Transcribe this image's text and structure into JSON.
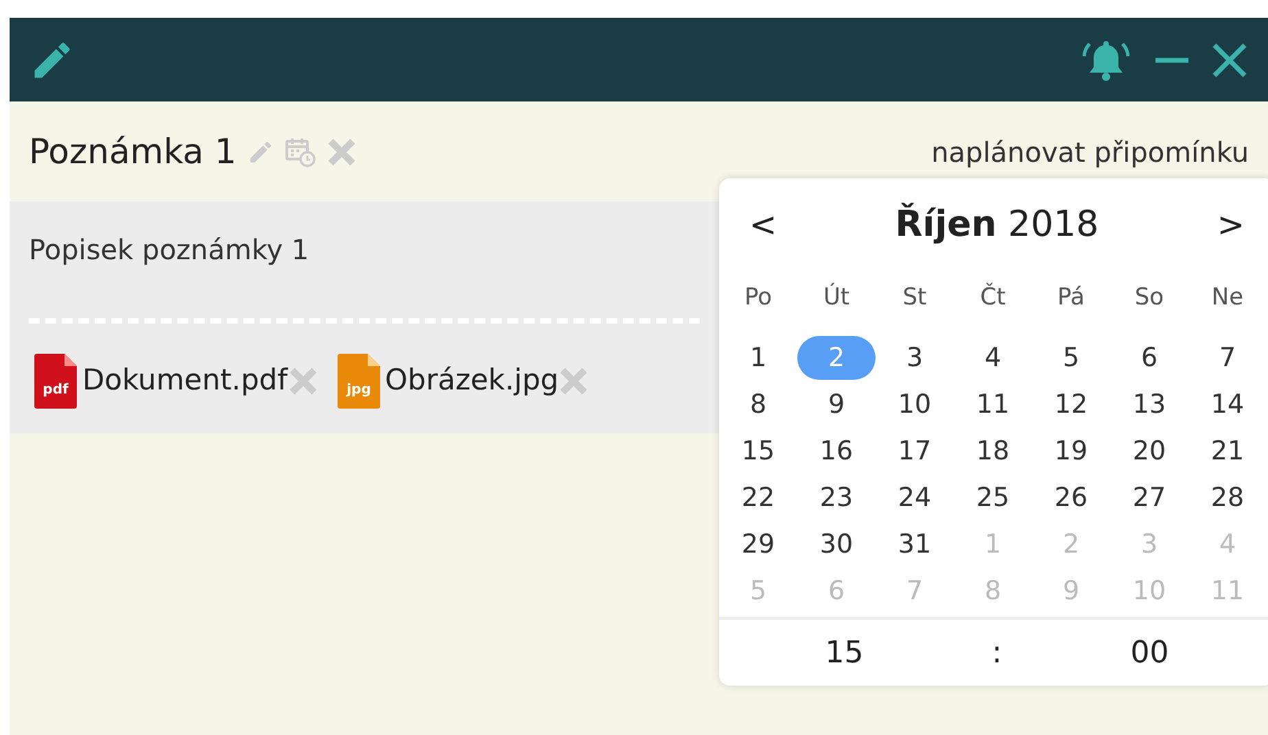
{
  "note": {
    "title": "Poznámka 1",
    "description": "Popisek poznámky 1",
    "attachments": [
      {
        "kind": "pdf",
        "badge": "pdf",
        "name": "Dokument.pdf"
      },
      {
        "kind": "jpg",
        "badge": "jpg",
        "name": "Obrázek.jpg"
      }
    ]
  },
  "reminder": {
    "label": "naplánovat připomínku"
  },
  "calendar": {
    "prev": "<",
    "next": ">",
    "month": "**Říjen** 2018",
    "weekdays": [
      "Po",
      "Út",
      "St",
      "Čt",
      "Pá",
      "So",
      "Ne"
    ],
    "days": [
      {
        "label": "1",
        "outside": false,
        "selected": false
      },
      {
        "label": "2",
        "outside": false,
        "selected": true
      },
      {
        "label": "3",
        "outside": false,
        "selected": false
      },
      {
        "label": "4",
        "outside": false,
        "selected": false
      },
      {
        "label": "5",
        "outside": false,
        "selected": false
      },
      {
        "label": "6",
        "outside": false,
        "selected": false
      },
      {
        "label": "7",
        "outside": false,
        "selected": false
      },
      {
        "label": "8",
        "outside": false,
        "selected": false
      },
      {
        "label": "9",
        "outside": false,
        "selected": false
      },
      {
        "label": "10",
        "outside": false,
        "selected": false
      },
      {
        "label": "11",
        "outside": false,
        "selected": false
      },
      {
        "label": "12",
        "outside": false,
        "selected": false
      },
      {
        "label": "13",
        "outside": false,
        "selected": false
      },
      {
        "label": "14",
        "outside": false,
        "selected": false
      },
      {
        "label": "15",
        "outside": false,
        "selected": false
      },
      {
        "label": "16",
        "outside": false,
        "selected": false
      },
      {
        "label": "17",
        "outside": false,
        "selected": false
      },
      {
        "label": "18",
        "outside": false,
        "selected": false
      },
      {
        "label": "19",
        "outside": false,
        "selected": false
      },
      {
        "label": "20",
        "outside": false,
        "selected": false
      },
      {
        "label": "21",
        "outside": false,
        "selected": false
      },
      {
        "label": "22",
        "outside": false,
        "selected": false
      },
      {
        "label": "23",
        "outside": false,
        "selected": false
      },
      {
        "label": "24",
        "outside": false,
        "selected": false
      },
      {
        "label": "25",
        "outside": false,
        "selected": false
      },
      {
        "label": "26",
        "outside": false,
        "selected": false
      },
      {
        "label": "27",
        "outside": false,
        "selected": false
      },
      {
        "label": "28",
        "outside": false,
        "selected": false
      },
      {
        "label": "29",
        "outside": false,
        "selected": false
      },
      {
        "label": "30",
        "outside": false,
        "selected": false
      },
      {
        "label": "31",
        "outside": false,
        "selected": false
      },
      {
        "label": "1",
        "outside": true,
        "selected": false
      },
      {
        "label": "2",
        "outside": true,
        "selected": false
      },
      {
        "label": "3",
        "outside": true,
        "selected": false
      },
      {
        "label": "4",
        "outside": true,
        "selected": false
      },
      {
        "label": "5",
        "outside": true,
        "selected": false
      },
      {
        "label": "6",
        "outside": true,
        "selected": false
      },
      {
        "label": "7",
        "outside": true,
        "selected": false
      },
      {
        "label": "8",
        "outside": true,
        "selected": false
      },
      {
        "label": "9",
        "outside": true,
        "selected": false
      },
      {
        "label": "10",
        "outside": true,
        "selected": false
      },
      {
        "label": "11",
        "outside": true,
        "selected": false
      }
    ],
    "time": {
      "hours": "15",
      "separator": ":",
      "minutes": "00"
    }
  }
}
